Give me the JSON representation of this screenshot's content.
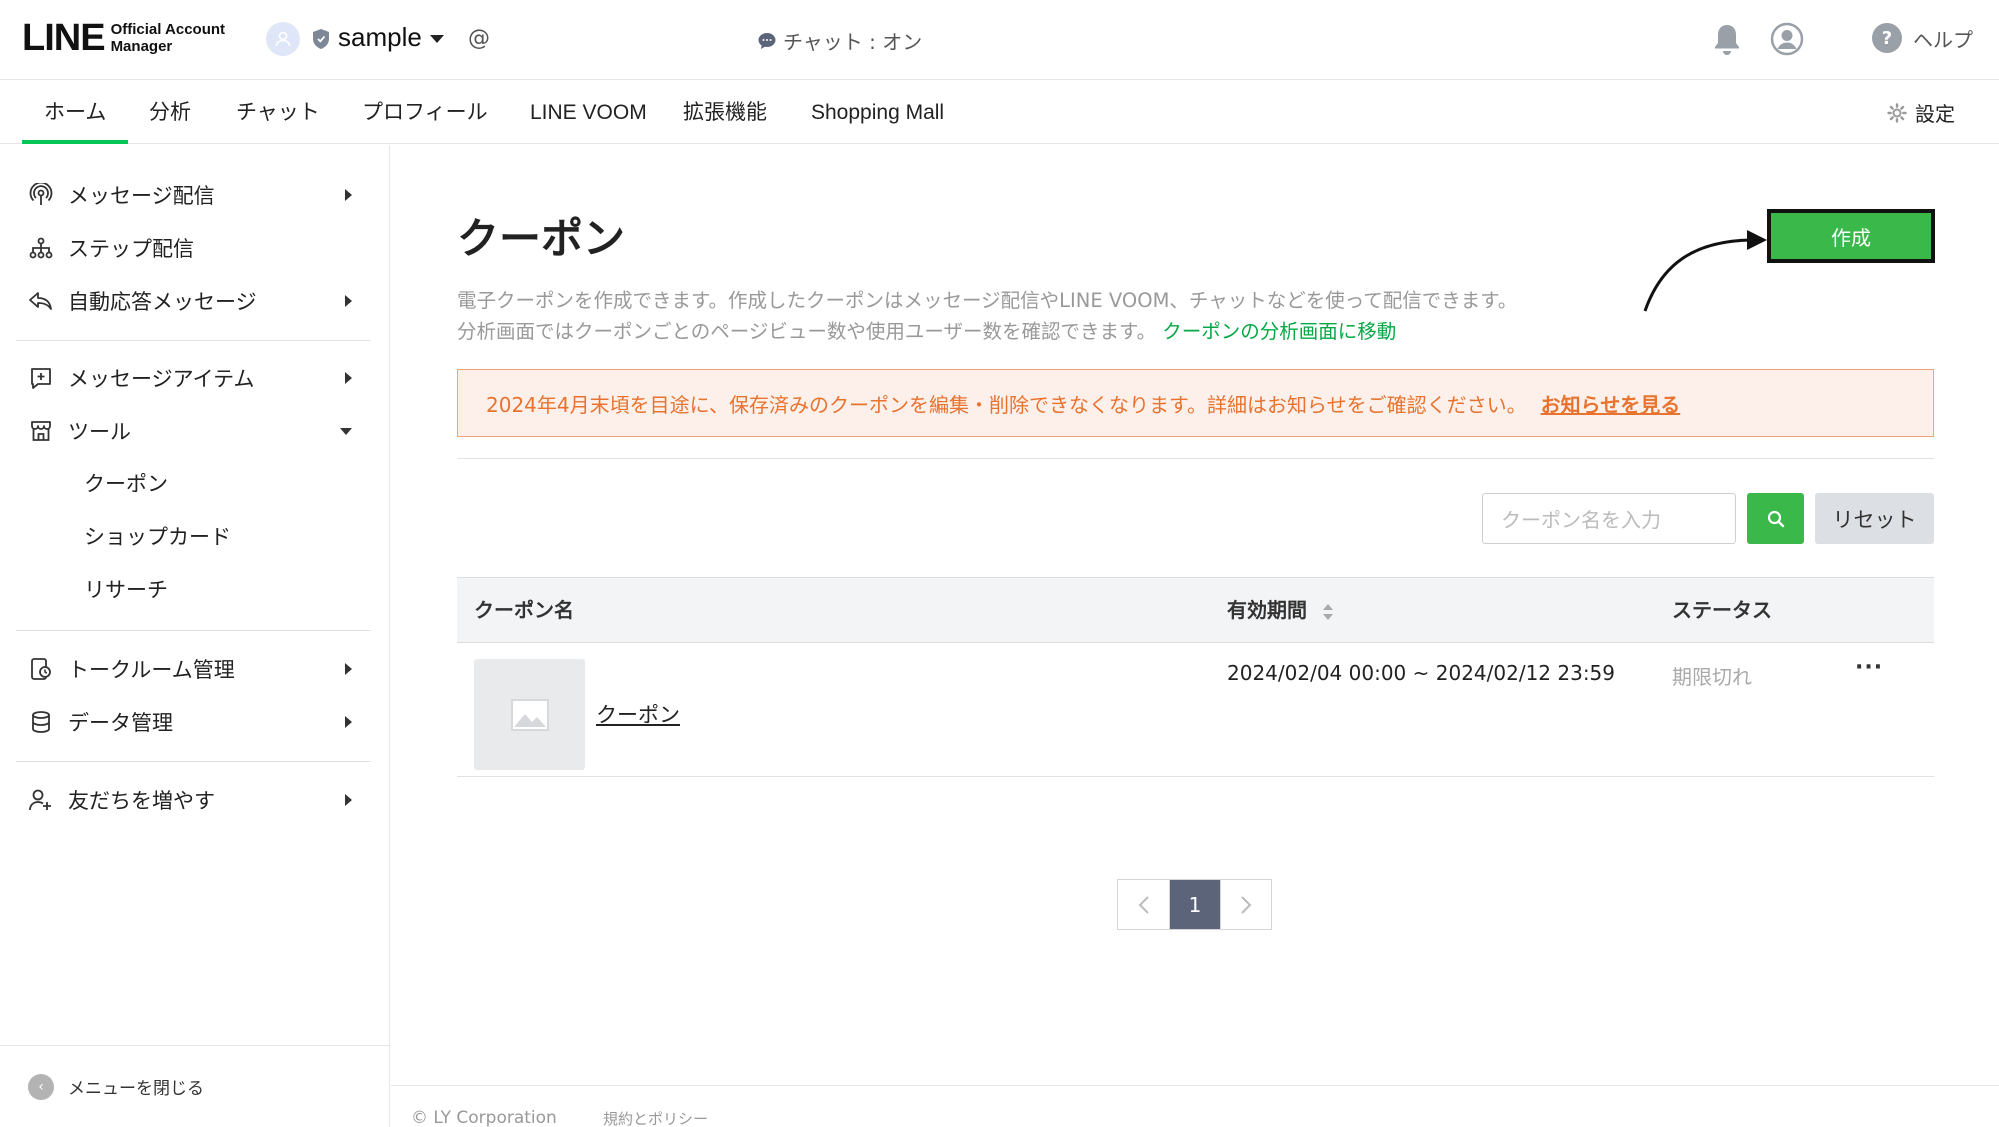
{
  "header": {
    "logo_main": "LINE",
    "logo_sub_1": "Official Account",
    "logo_sub_2": "Manager",
    "account_name": "sample",
    "account_id": "@",
    "chat_status": "チャット : オン",
    "help_label": "ヘルプ"
  },
  "nav": {
    "tabs": [
      "ホーム",
      "分析",
      "チャット",
      "プロフィール",
      "LINE VOOM",
      "拡張機能",
      "Shopping Mall"
    ],
    "active": "ホーム",
    "settings_label": "設定"
  },
  "sidebar": {
    "items": [
      "メッセージ配信",
      "ステップ配信",
      "自動応答メッセージ",
      "メッセージアイテム",
      "ツール",
      "トークルーム管理",
      "データ管理",
      "友だちを増やす"
    ],
    "tool_subitems": [
      "クーポン",
      "ショップカード",
      "リサーチ"
    ],
    "close_label": "メニューを閉じる"
  },
  "main": {
    "title": "クーポン",
    "create_label": "作成",
    "description_line1": "電子クーポンを作成できます。作成したクーポンはメッセージ配信やLINE VOOM、チャットなどを使って配信できます。",
    "description_line2": "分析画面ではクーポンごとのページビュー数や使用ユーザー数を確認できます。",
    "analysis_link": "クーポンの分析画面に移動",
    "notice_text": "2024年4月末頃を目途に、保存済みのクーポンを編集・削除できなくなります。詳細はお知らせをご確認ください。",
    "notice_link": "お知らせを見る",
    "search_placeholder": "クーポン名を入力",
    "reset_label": "リセット",
    "table": {
      "headers": [
        "クーポン名",
        "有効期間",
        "ステータス"
      ],
      "rows": [
        {
          "name": "クーポン",
          "period": "2024/02/04 00:00 ~ 2024/02/12 23:59",
          "status": "期限切れ",
          "more": "···"
        }
      ]
    },
    "pagination": {
      "current": "1"
    }
  },
  "footer": {
    "copyright": "© LY Corporation",
    "terms": "規約とポリシー"
  },
  "colors": {
    "accent_green": "#06c755",
    "button_green": "#3ab84a",
    "notice_orange": "#e8732f",
    "pager_active": "#5b6478"
  }
}
